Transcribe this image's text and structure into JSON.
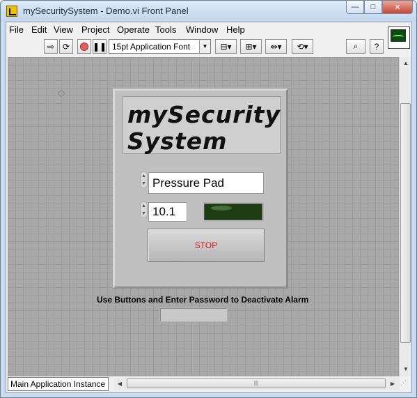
{
  "window": {
    "title": "mySecuritySystem - Demo.vi Front Panel",
    "minimize": "—",
    "maximize": "□",
    "close": "✕"
  },
  "menu": [
    {
      "label": "File"
    },
    {
      "label": "Edit"
    },
    {
      "label": "View"
    },
    {
      "label": "Project"
    },
    {
      "label": "Operate"
    },
    {
      "label": "Tools"
    },
    {
      "label": "Window"
    },
    {
      "label": "Help"
    }
  ],
  "toolbar": {
    "font": "15pt Application Font",
    "icons": [
      "run-arrow-icon",
      "run-continuously-icon",
      "abort-icon",
      "pause-icon",
      "align-icon",
      "distribute-icon",
      "resize-icon",
      "reorder-icon",
      "search-icon",
      "help-icon"
    ]
  },
  "panel": {
    "title_line1": "mySecurity",
    "title_line2": "System",
    "sensor_ring": "Pressure Pad",
    "numeric_value": "10.1",
    "stop_label": "STOP",
    "instruction": "Use Buttons and Enter Password to Deactivate Alarm",
    "password_value": ""
  },
  "status": {
    "context": "Main Application Instance"
  },
  "colors": {
    "led_off": "#1e3c12",
    "stop_text": "#d21818",
    "panel_bg": "#a8a8a8"
  }
}
